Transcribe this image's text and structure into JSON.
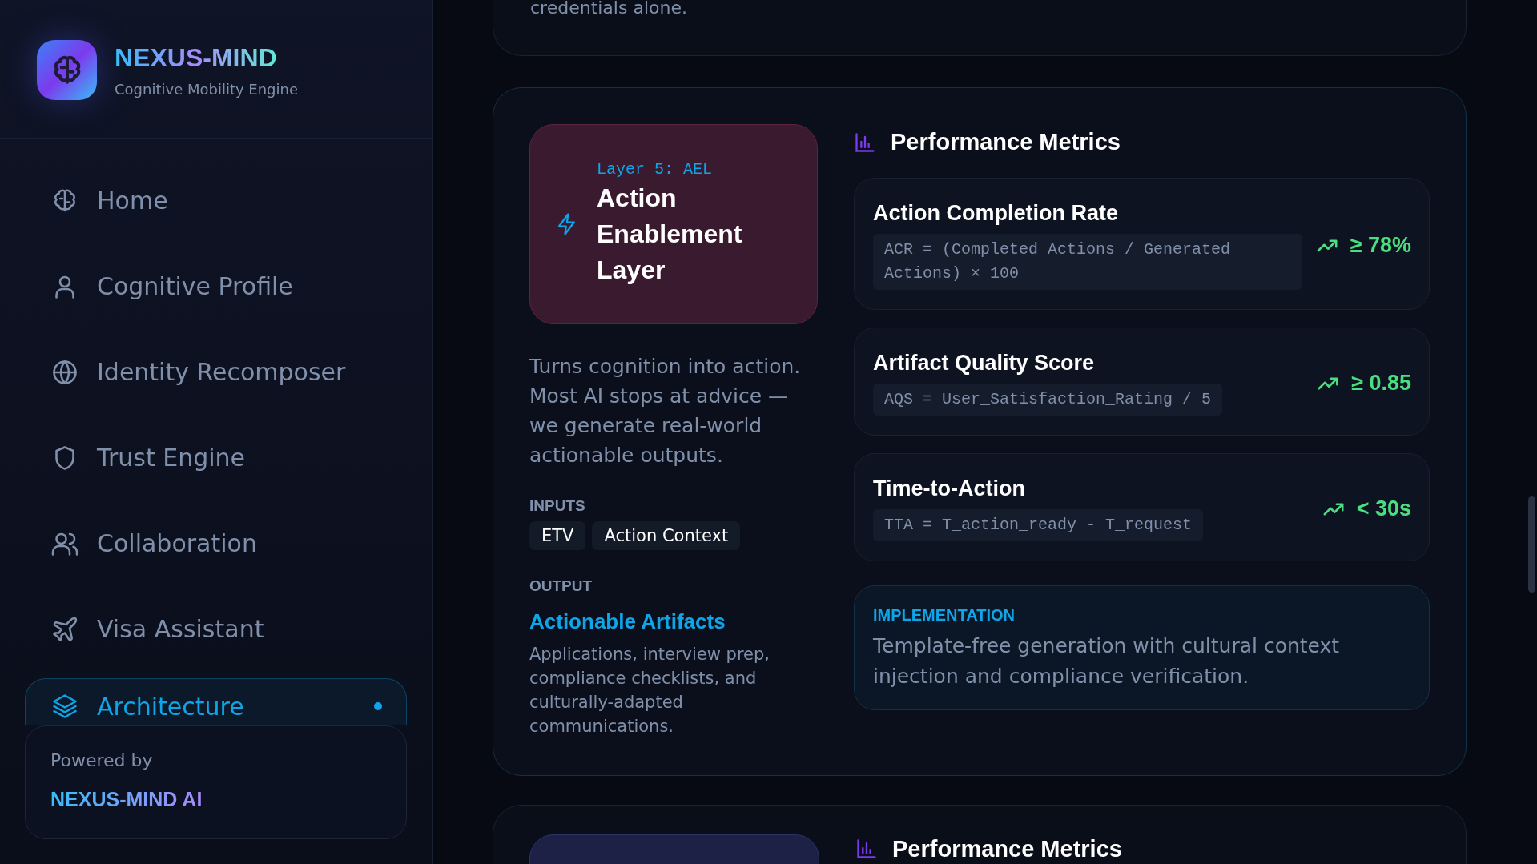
{
  "brand": {
    "name": "NEXUS-MIND",
    "tagline": "Cognitive Mobility Engine"
  },
  "nav": [
    {
      "label": "Home",
      "selected": false
    },
    {
      "label": "Cognitive Profile",
      "selected": false
    },
    {
      "label": "Identity Recomposer",
      "selected": false
    },
    {
      "label": "Trust Engine",
      "selected": false
    },
    {
      "label": "Collaboration",
      "selected": false
    },
    {
      "label": "Visa Assistant",
      "selected": false
    },
    {
      "label": "Architecture",
      "selected": true
    }
  ],
  "footer": {
    "caption": "Powered by",
    "name": "NEXUS-MIND AI"
  },
  "previous_section": {
    "text": "credentials alone."
  },
  "layer": {
    "tag": "Layer 5: AEL",
    "title": "Action Enablement Layer",
    "description": "Turns cognition into action. Most AI stops at advice — we generate real-world actionable outputs.",
    "inputs_label": "INPUTS",
    "inputs": [
      "ETV",
      "Action Context"
    ],
    "output_label": "OUTPUT",
    "output_title": "Actionable Artifacts",
    "output_description": "Applications, interview prep, compliance checklists, and culturally-adapted communications."
  },
  "metrics": {
    "title": "Performance Metrics",
    "items": [
      {
        "name": "Action Completion Rate",
        "formula": "ACR = (Completed Actions / Generated Actions) × 100",
        "target": "≥ 78%"
      },
      {
        "name": "Artifact Quality Score",
        "formula": "AQS = User_Satisfaction_Rating / 5",
        "target": "≥ 0.85"
      },
      {
        "name": "Time-to-Action",
        "formula": "TTA = T_action_ready - T_request",
        "target": "< 30s"
      }
    ],
    "implementation": {
      "label": "IMPLEMENTATION",
      "text": "Template-free generation with cultural context injection and compliance verification."
    }
  },
  "next_section": {
    "metrics_title": "Performance Metrics"
  }
}
